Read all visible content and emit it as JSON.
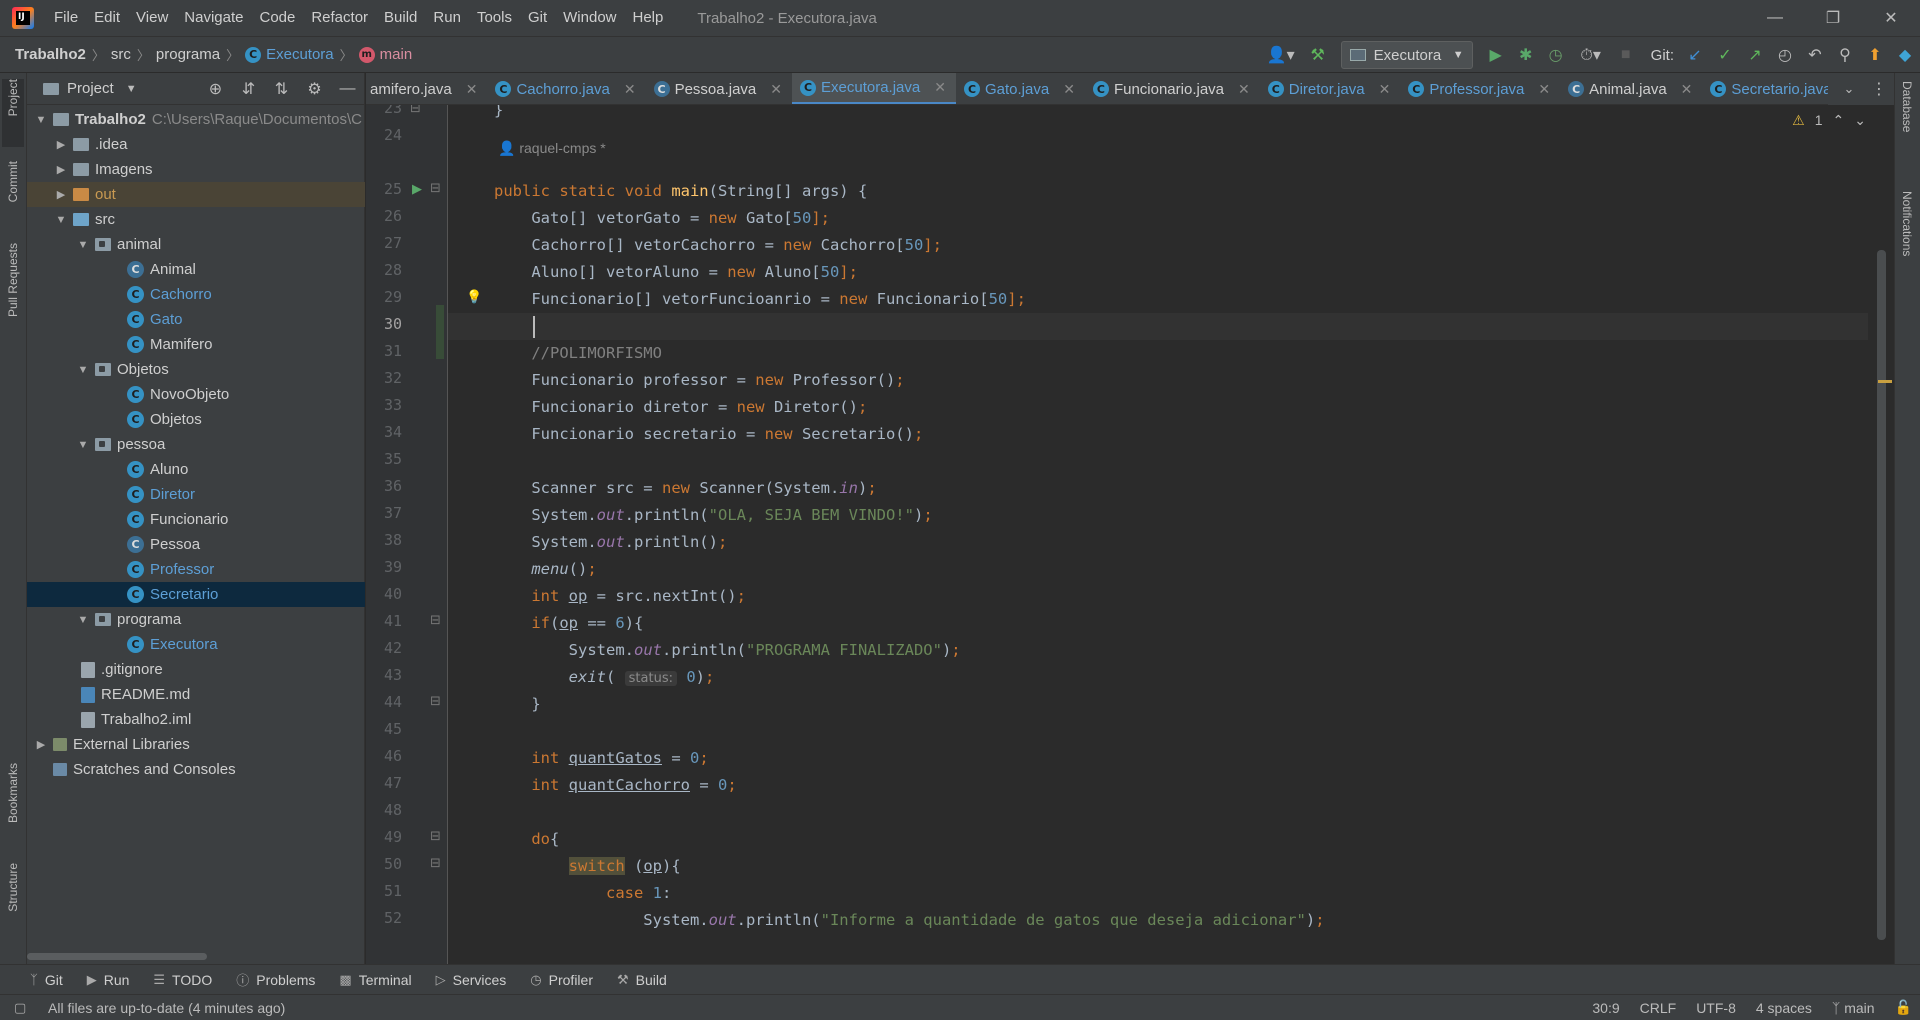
{
  "menu": {
    "items": [
      "File",
      "Edit",
      "View",
      "Navigate",
      "Code",
      "Refactor",
      "Build",
      "Run",
      "Tools",
      "Git",
      "Window",
      "Help"
    ],
    "window_title": "Trabalho2 - Executora.java"
  },
  "breadcrumb": {
    "project": "Trabalho2",
    "src": "src",
    "package": "programa",
    "class": "Executora",
    "method": "main"
  },
  "toolbar": {
    "run_config": "Executora",
    "git_label": "Git:"
  },
  "left_stripe": {
    "project": "Project",
    "commit": "Commit",
    "pull_requests": "Pull Requests",
    "bookmarks": "Bookmarks",
    "structure": "Structure"
  },
  "right_stripe": {
    "database": "Database",
    "notifications": "Notifications"
  },
  "project_panel": {
    "title": "Project",
    "tree": [
      {
        "label": "Trabalho2",
        "path": "C:\\Users\\Raque\\Documentos\\C"
      },
      {
        "label": ".idea"
      },
      {
        "label": "Imagens"
      },
      {
        "label": "out"
      },
      {
        "label": "src"
      },
      {
        "label": "animal"
      },
      {
        "label": "Animal"
      },
      {
        "label": "Cachorro"
      },
      {
        "label": "Gato"
      },
      {
        "label": "Mamifero"
      },
      {
        "label": "Objetos"
      },
      {
        "label": "NovoObjeto"
      },
      {
        "label": "Objetos"
      },
      {
        "label": "pessoa"
      },
      {
        "label": "Aluno"
      },
      {
        "label": "Diretor"
      },
      {
        "label": "Funcionario"
      },
      {
        "label": "Pessoa"
      },
      {
        "label": "Professor"
      },
      {
        "label": "Secretario"
      },
      {
        "label": "programa"
      },
      {
        "label": "Executora"
      },
      {
        "label": ".gitignore"
      },
      {
        "label": "README.md"
      },
      {
        "label": "Trabalho2.iml"
      },
      {
        "label": "External Libraries"
      },
      {
        "label": "Scratches and Consoles"
      }
    ]
  },
  "tabs": [
    "amifero.java",
    "Cachorro.java",
    "Pessoa.java",
    "Executora.java",
    "Gato.java",
    "Funcionario.java",
    "Diretor.java",
    "Professor.java",
    "Animal.java",
    "Secretario.java"
  ],
  "editor": {
    "warning_count": "1",
    "author": "raquel-cmps *",
    "lines": [
      "23",
      "24",
      "25",
      "26",
      "27",
      "28",
      "29",
      "30",
      "31",
      "32",
      "33",
      "34",
      "35",
      "36",
      "37",
      "38",
      "39",
      "40",
      "41",
      "42",
      "43",
      "44",
      "45",
      "46",
      "47",
      "48",
      "49",
      "50",
      "51",
      "52"
    ],
    "code": {
      "l23": "}",
      "l25a": "public static void ",
      "l25b": "main",
      "l25c": "(String[] args) {",
      "l26a": "    Gato[] vetorGato = ",
      "l26b": "new ",
      "l26c": "Gato[",
      "l26d": "50",
      "l26e": "];",
      "l27a": "    Cachorro[] vetorCachorro = ",
      "l27b": "new ",
      "l27c": "Cachorro[",
      "l27d": "50",
      "l27e": "];",
      "l28a": "    Aluno[] vetorAluno = ",
      "l28b": "new ",
      "l28c": "Aluno[",
      "l28d": "50",
      "l28e": "];",
      "l29a": "    Funcionario[] vetorFuncioanrio = ",
      "l29b": "new ",
      "l29c": "Funcionario[",
      "l29d": "50",
      "l29e": "];",
      "l31": "    //POLIMORFISMO",
      "l32a": "    Funcionario professor = ",
      "l32b": "new ",
      "l32c": "Professor()",
      "l32d": ";",
      "l33a": "    Funcionario diretor = ",
      "l33b": "new ",
      "l33c": "Diretor()",
      "l33d": ";",
      "l34a": "    Funcionario secretario = ",
      "l34b": "new ",
      "l34c": "Secretario()",
      "l34d": ";",
      "l36a": "    Scanner src = ",
      "l36b": "new ",
      "l36c": "Scanner(System.",
      "l36d": "in",
      "l36e": ")",
      "l36f": ";",
      "l37a": "    System.",
      "l37b": "out",
      "l37c": ".println(",
      "l37d": "\"OLA, SEJA BEM VINDO!\"",
      "l37e": ")",
      "l37f": ";",
      "l38a": "    System.",
      "l38b": "out",
      "l38c": ".println()",
      "l38d": ";",
      "l39a": "    ",
      "l39b": "menu",
      "l39c": "()",
      "l39d": ";",
      "l40a": "    ",
      "l40b": "int ",
      "l40c": "op",
      "l40d": " = src.nextInt()",
      "l40e": ";",
      "l41a": "    ",
      "l41b": "if",
      "l41c": "(",
      "l41d": "op",
      "l41e": " == ",
      "l41f": "6",
      "l41g": "){",
      "l42a": "        System.",
      "l42b": "out",
      "l42c": ".println(",
      "l42d": "\"PROGRAMA FINALIZADO\"",
      "l42e": ")",
      "l42f": ";",
      "l43a": "        ",
      "l43b": "exit",
      "l43c": "( ",
      "l43hint": "status:",
      "l43d": " ",
      "l43e": "0",
      "l43f": ")",
      "l43g": ";",
      "l44": "    }",
      "l46a": "    ",
      "l46b": "int ",
      "l46c": "quantGatos",
      "l46d": " = ",
      "l46e": "0",
      "l46f": ";",
      "l47a": "    ",
      "l47b": "int ",
      "l47c": "quantCachorro",
      "l47d": " = ",
      "l47e": "0",
      "l47f": ";",
      "l49a": "    ",
      "l49b": "do",
      "l49c": "{",
      "l50a": "        ",
      "l50b": "switch",
      "l50c": " (",
      "l50d": "op",
      "l50e": "){",
      "l51a": "            ",
      "l51b": "case ",
      "l51c": "1",
      "l51d": ":",
      "l52a": "                System.",
      "l52b": "out",
      "l52c": ".println(",
      "l52d": "\"Informe a quantidade de gatos que deseja adicionar\"",
      "l52e": ")",
      "l52f": ";"
    }
  },
  "bottom_tools": [
    "Git",
    "Run",
    "TODO",
    "Problems",
    "Terminal",
    "Services",
    "Profiler",
    "Build"
  ],
  "status": {
    "message": "All files are up-to-date (4 minutes ago)",
    "position": "30:9",
    "line_sep": "CRLF",
    "encoding": "UTF-8",
    "indent": "4 spaces",
    "branch": "main"
  }
}
